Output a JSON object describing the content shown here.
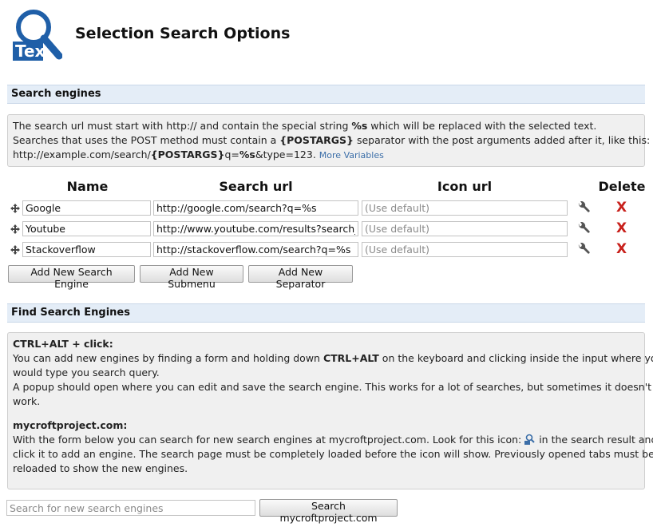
{
  "header": {
    "title": "Selection Search Options",
    "logo_text": "Tex"
  },
  "search_engines": {
    "section_title": "Search engines",
    "info": {
      "line1_pre": "The search url must start with http:// and contain the special string ",
      "line1_token": "%s",
      "line1_post": " which will be replaced with the selected text.",
      "line2_pre": "Searches that uses the POST method must contain a ",
      "line2_token": "{POSTARGS}",
      "line2_post": " separator with the post arguments added after it, like this:",
      "line3_pre": "http://example.com/search/",
      "line3_token1": "{POSTARGS}",
      "line3_mid": "q=",
      "line3_token2": "%s",
      "line3_post": "&type=123.",
      "more_variables_link": "More Variables"
    },
    "columns": {
      "name": "Name",
      "search_url": "Search url",
      "icon_url": "Icon url",
      "delete": "Delete"
    },
    "rows": [
      {
        "name": "Google",
        "url": "http://google.com/search?q=%s",
        "icon_placeholder": "(Use default)",
        "delete_label": "X"
      },
      {
        "name": "Youtube",
        "url": "http://www.youtube.com/results?search_query=%s",
        "icon_placeholder": "(Use default)",
        "delete_label": "X"
      },
      {
        "name": "Stackoverflow",
        "url": "http://stackoverflow.com/search?q=%s",
        "icon_placeholder": "(Use default)",
        "delete_label": "X"
      }
    ],
    "buttons": {
      "add_engine": "Add New Search Engine",
      "add_submenu": "Add New Submenu",
      "add_separator": "Add New Separator"
    }
  },
  "find_engines": {
    "section_title": "Find Search Engines",
    "ctrl_alt": {
      "heading": "CTRL+ALT + click:",
      "line1_pre": "You can add new engines by finding a form and holding down ",
      "line1_token": "CTRL+ALT",
      "line1_post": " on the keyboard and clicking inside the input where you",
      "line2": "would type you search query.",
      "line3": "A popup should open where you can edit and save the search engine. This works for a lot of searches, but sometimes it doesn't",
      "line4": "work."
    },
    "mycroft": {
      "heading": "mycroftproject.com:",
      "line1_pre": "With the form below you can search for new search engines at mycroftproject.com. Look for this icon:",
      "line1_post": " in the search result and",
      "line2": "click it to add an engine. The search page must be completely loaded before the icon will show. Previously opened tabs must be",
      "line3": "reloaded to show the new engines."
    },
    "search_placeholder": "Search for new search engines",
    "search_button": "Search mycroftproject.com"
  },
  "colors": {
    "section_header_bg": "#e4edf7",
    "info_box_bg": "#f0f0f0",
    "delete_red": "#c8201b",
    "link_blue": "#3b6ea8",
    "logo_blue": "#1f5fa8"
  }
}
